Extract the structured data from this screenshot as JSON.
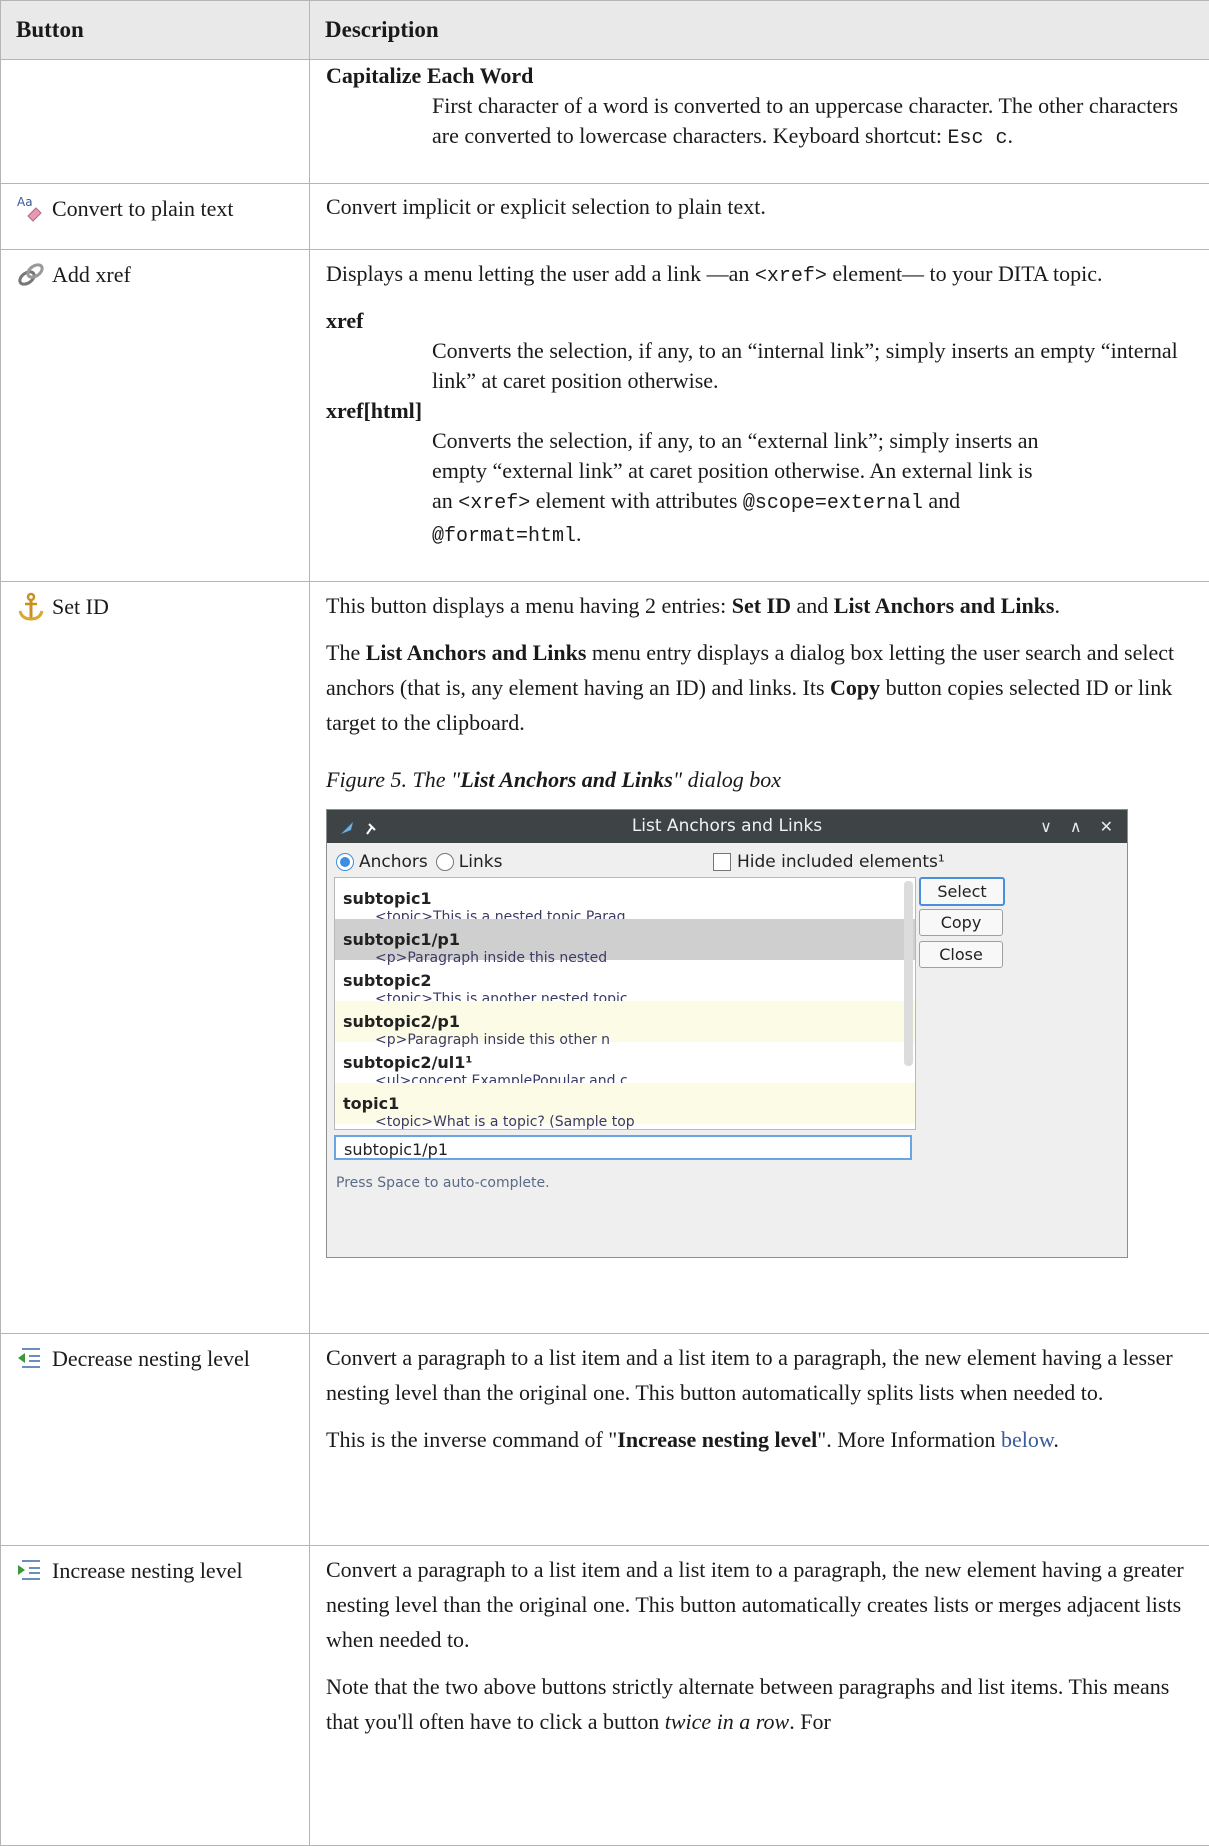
{
  "header": {
    "col_button": "Button",
    "col_description": "Description"
  },
  "rows": {
    "capitalize": {
      "term": "Capitalize Each Word",
      "def_a": "First character of a word is converted to an uppercase character. The other characters are converted to lowercase characters. Keyboard shortcut: ",
      "def_code": "Esc c",
      "def_b": "."
    },
    "plain": {
      "button": "Convert to plain text",
      "desc": "Convert implicit or explicit selection to plain text."
    },
    "xref": {
      "button": "Add xref",
      "desc_a": "Displays a menu letting the user add a link —an ",
      "desc_code": "<xref>",
      "desc_b": " element— to your DITA topic.",
      "term1": "xref",
      "def1": "Converts the selection, if any, to an “internal link”; simply inserts an empty “internal link” at caret position otherwise.",
      "term2": "xref[html]",
      "def2_a": "Converts the selection, if any, to an “external link”; simply inserts an empty “external link” at caret position otherwise. An external link is an ",
      "def2_code1": "<xref>",
      "def2_b": " element with attributes ",
      "def2_code2": "@scope=external",
      "def2_c": " and ",
      "def2_code3": "@format=html",
      "def2_d": "."
    },
    "setid": {
      "button": "Set ID",
      "p1_a": "This button displays a menu having 2 entries: ",
      "p1_b1": "Set ID",
      "p1_c": " and ",
      "p1_b2": "List Anchors and Links",
      "p1_d": ".",
      "p2_a": "The ",
      "p2_b": "List Anchors and Links",
      "p2_c": " menu entry displays a dialog box letting the user search and select anchors (that is, any element having an ID) and links. Its ",
      "p2_d": "Copy",
      "p2_e": " button copies selected ID or link target to the clipboard.",
      "fig_a": "Figure 5. The \"",
      "fig_b": "List Anchors and Links",
      "fig_c": "\" dialog box"
    },
    "decrease": {
      "button": "Decrease nesting level",
      "p1": "Convert a paragraph to a list item and a list item to a paragraph, the new element having a lesser nesting level than the original one. This button automatically splits lists when needed to.",
      "p2_a": "This is the inverse command of \"",
      "p2_b": "Increase nesting level",
      "p2_c": "\". More Information ",
      "p2_link": "below",
      "p2_d": "."
    },
    "increase": {
      "button": "Increase nesting level",
      "p1": "Convert a paragraph to a list item and a list item to a paragraph, the new element having a greater nesting level than the original one. This button automatically creates lists or merges adjacent lists when needed to.",
      "p2_a": "Note that the two above buttons strictly alternate between paragraphs and list items. This means that you'll often have to click a button ",
      "p2_em": "twice in a row",
      "p2_b": ". For"
    }
  },
  "dialog": {
    "title": "List Anchors and Links",
    "radio_anchors": "Anchors",
    "radio_links": "Links",
    "hide_label": "Hide included elements¹",
    "items": [
      {
        "id": "subtopic1",
        "snippet": "<topic>This is a nested topic Parag",
        "state": "normal"
      },
      {
        "id": "subtopic1/p1",
        "snippet": "<p>Paragraph inside this nested",
        "state": "selected"
      },
      {
        "id": "subtopic2",
        "snippet": "<topic>This is another nested topic",
        "state": "normal"
      },
      {
        "id": "subtopic2/p1",
        "snippet": "<p>Paragraph inside this other n",
        "state": "highlight"
      },
      {
        "id": "subtopic2/ul1¹",
        "snippet": "<ul>concept ExamplePopular and c",
        "state": "normal"
      },
      {
        "id": "topic1",
        "snippet": "<topic>What is a topic? (Sample top",
        "state": "highlight"
      }
    ],
    "select_label": "Select",
    "copy_label": "Copy",
    "close_label": "Close",
    "input_value": "subtopic1/p1",
    "hint": "Press Space to auto-complete."
  }
}
